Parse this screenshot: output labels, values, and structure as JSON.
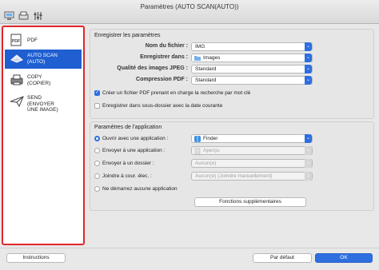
{
  "window": {
    "title": "Paramètres (AUTO SCAN(AUTO))"
  },
  "toolbar": {
    "icons": [
      "scan-from-computer-icon",
      "scan-from-panel-icon",
      "general-settings-icon"
    ]
  },
  "sidebar": {
    "items": [
      {
        "label": "PDF",
        "icon": "pdf-icon",
        "selected": false
      },
      {
        "label": "AUTO SCAN\n(AUTO)",
        "icon": "auto-scan-icon",
        "selected": true
      },
      {
        "label": "COPY\n(COPIER)",
        "icon": "copy-icon",
        "selected": false
      },
      {
        "label": "SEND\n(ENVOYER\nUNE IMAGE)",
        "icon": "send-icon",
        "selected": false
      }
    ]
  },
  "save_settings": {
    "title": "Enregistrer les paramètres",
    "file_name_label": "Nom du fichier :",
    "file_name_value": "IMG",
    "save_in_label": "Enregistrer dans :",
    "save_in_value": "Images",
    "jpeg_quality_label": "Qualité des images JPEG :",
    "jpeg_quality_value": "Standard",
    "pdf_compression_label": "Compression PDF :",
    "pdf_compression_value": "Standard",
    "keyword_pdf_label": "Créer un fichier PDF prenant en charge la recherche par mot clé",
    "keyword_pdf_checked": true,
    "subfolder_label": "Enregistrer dans sous-dossier avec la date courante",
    "subfolder_checked": false
  },
  "app_settings": {
    "title": "Paramètres de l'application",
    "open_with_label": "Ouvrir avec une application :",
    "open_with_value": "Finder",
    "send_to_app_label": "Envoyer à une application :",
    "send_to_app_value": "Aperçu",
    "send_to_folder_label": "Envoyer à un dossier :",
    "send_to_folder_value": "Aucun(e)",
    "attach_email_label": "Joindre à cour. élec. :",
    "attach_email_value": "Aucun(e) (Joindre manuellement)",
    "no_app_label": "Ne démarrez aucune application",
    "more_functions_label": "Fonctions supplémentaires",
    "selected_option": "open_with"
  },
  "footer": {
    "instructions_label": "Instructions",
    "defaults_label": "Par défaut",
    "ok_label": "OK"
  },
  "colors": {
    "accent": "#2e6fe0",
    "selection": "#1f5fd1",
    "highlight_border": "#e0262c"
  }
}
